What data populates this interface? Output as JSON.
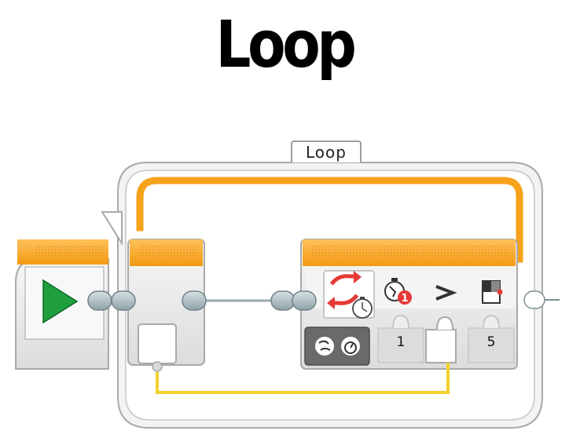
{
  "title": "Loop",
  "loop_block": {
    "tab_label": "Loop",
    "mode_icon": "timer-mode-icon",
    "params": {
      "port_icon": "timer-port-icon",
      "timer_id": "1",
      "comparison": ">",
      "threshold": "5"
    }
  },
  "start_block": {
    "icon": "play-icon"
  },
  "colors": {
    "orange": "#f7a21b",
    "play_green": "#1f9e3d",
    "yellow_wire": "#f2d22c",
    "red_accent": "#e53935"
  }
}
